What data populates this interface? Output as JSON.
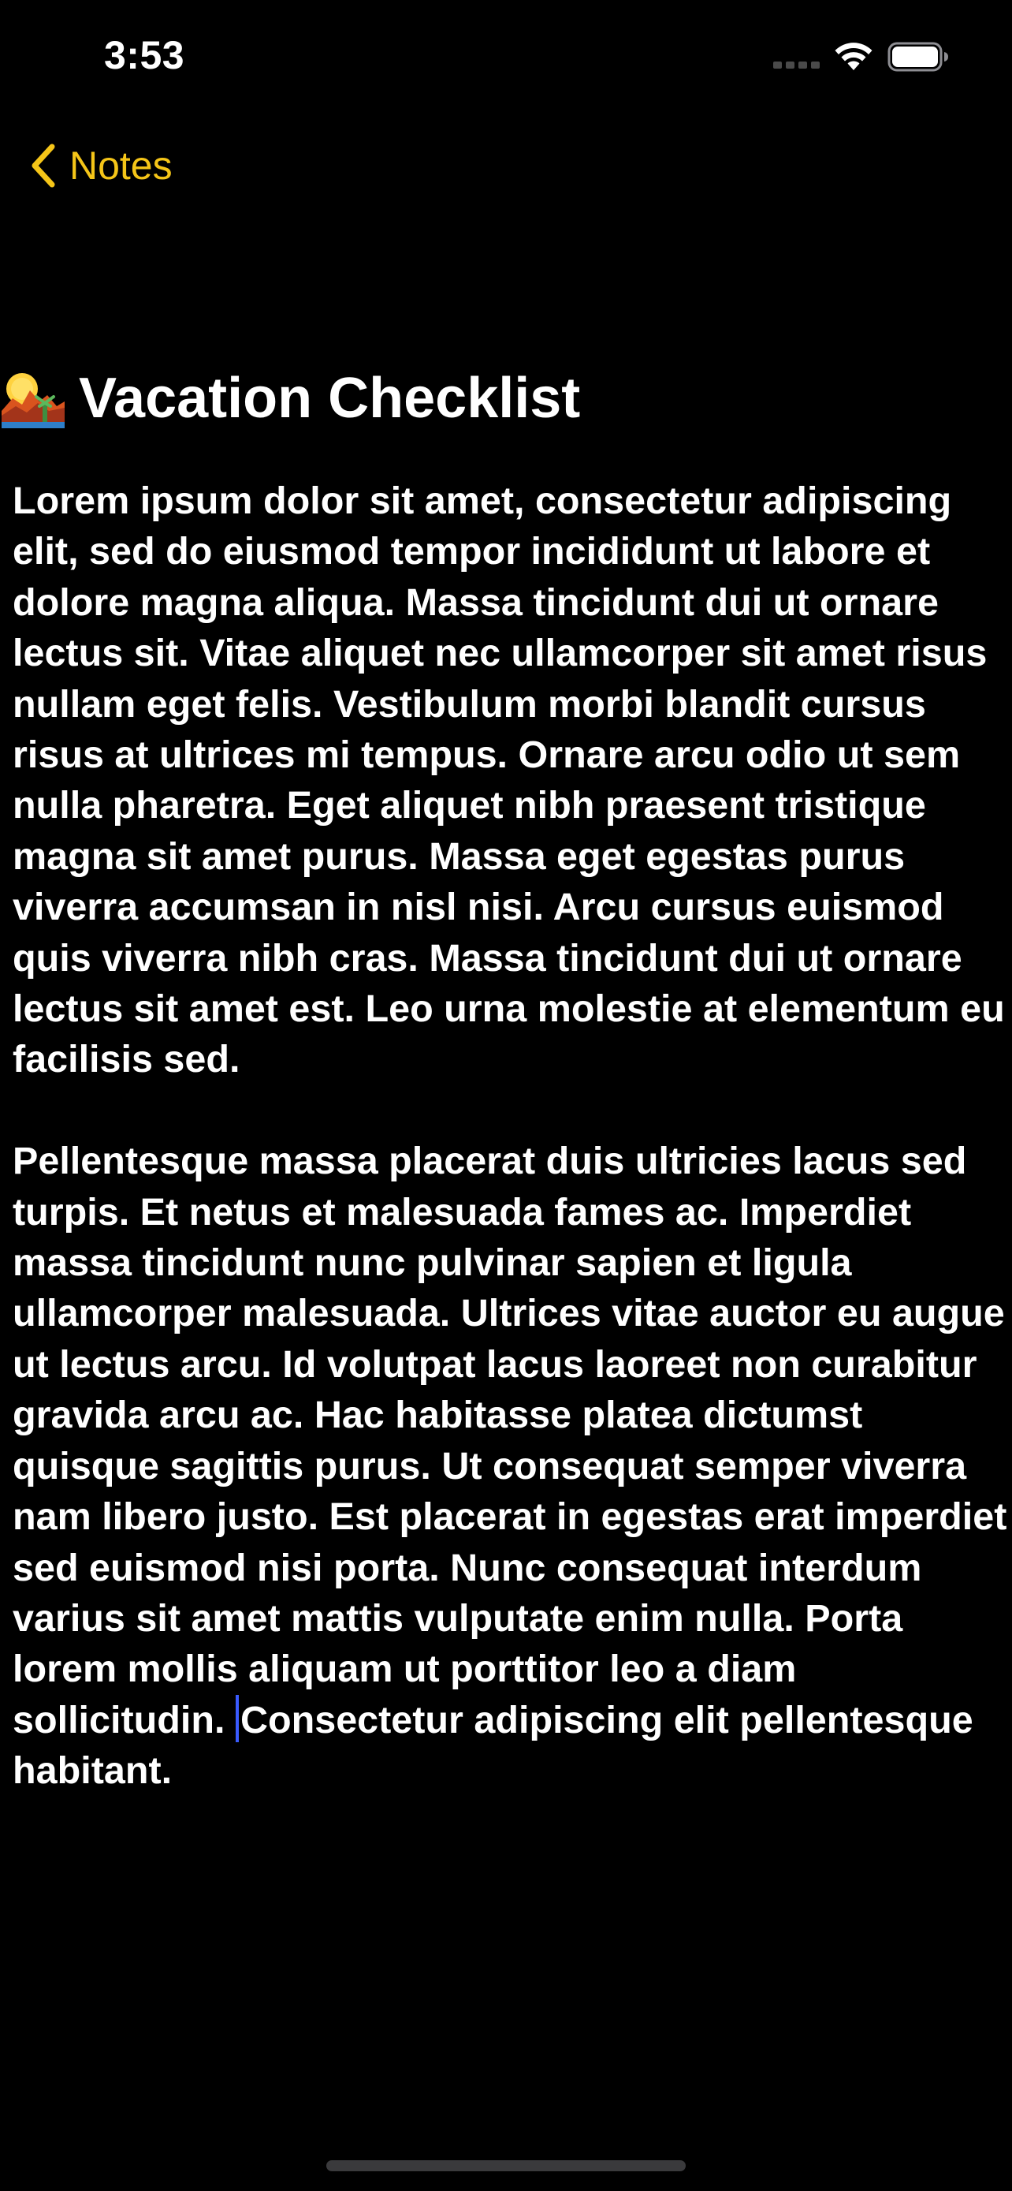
{
  "status_bar": {
    "time": "3:53",
    "icons": [
      "cellular-signal-icon",
      "wifi-icon",
      "battery-icon"
    ]
  },
  "nav": {
    "back_label": "Notes",
    "back_icon": "chevron-left-icon",
    "accent_color": "#f5c518"
  },
  "note": {
    "title_emoji": "sunset-emoji-icon",
    "title": "Vacation Checklist",
    "paragraph_1": "Lorem ipsum dolor sit amet, consectetur adipiscing elit, sed do eiusmod tempor incididunt ut labore et dolore magna aliqua. Massa tincidunt dui ut ornare lectus sit. Vitae aliquet nec ullamcorper sit amet risus nullam eget felis. Vestibulum morbi blandit cursus risus at ultrices mi tempus. Ornare arcu odio ut sem nulla pharetra. Eget aliquet nibh praesent tristique magna sit amet purus. Massa eget egestas purus viverra accumsan in nisl nisi. Arcu cursus euismod quis viverra nibh cras. Massa tincidunt dui ut ornare lectus sit amet est. Leo urna molestie at elementum eu facilisis sed.",
    "paragraph_2_before_cursor": "Pellentesque massa placerat duis ultricies lacus sed turpis. Et netus et malesuada fames ac. Imperdiet massa tincidunt nunc pulvinar sapien et ligula ullamcorper malesuada. Ultrices vitae auctor eu augue ut lectus arcu. Id volutpat lacus laoreet non curabitur gravida arcu ac. Hac habitasse platea dictumst quisque sagittis purus. Ut consequat semper viverra nam libero justo. Est placerat in egestas erat imperdiet sed euismod nisi porta. Nunc consequat interdum varius sit amet mattis vulputate enim nulla. Porta lorem mollis aliquam ut porttitor leo a diam sollicitudin. ",
    "paragraph_2_after_cursor": "Consectetur adipiscing elit pellentesque habitant.",
    "cursor_color": "#3a5bff"
  }
}
